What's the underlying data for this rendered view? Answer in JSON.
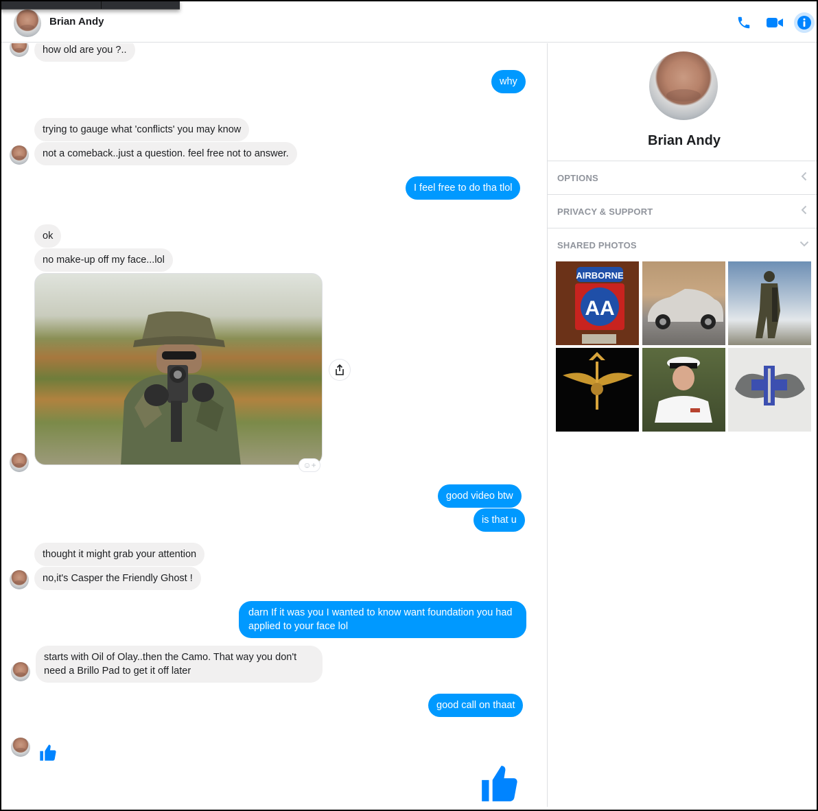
{
  "header": {
    "contact_name": "Brian Andy",
    "icons": [
      "phone-icon",
      "video-camera-icon",
      "info-icon"
    ],
    "accent_color": "#0084ff"
  },
  "messages": [
    {
      "from": "them",
      "text": "how old are you ?.."
    },
    {
      "from": "me",
      "text": "why"
    },
    {
      "from": "them",
      "text": "trying to gauge what 'conflicts' you may know"
    },
    {
      "from": "them",
      "text": "not a comeback..just a question. feel free not to answer."
    },
    {
      "from": "me",
      "text": "I feel free to do tha tlol"
    },
    {
      "from": "them",
      "text": "ok"
    },
    {
      "from": "them",
      "text": "no make-up off my face...lol"
    },
    {
      "from": "them",
      "type": "photo",
      "description_icon": "photo-soldier"
    },
    {
      "from": "me",
      "text": "good video btw"
    },
    {
      "from": "me",
      "text": "is that u"
    },
    {
      "from": "them",
      "text": "thought it might grab your attention"
    },
    {
      "from": "them",
      "text": "no,it's Casper the Friendly Ghost !"
    },
    {
      "from": "me",
      "text": "darn If it was you I wanted to know want foundation you had applied to your face lol"
    },
    {
      "from": "them",
      "text": "starts with Oil of Olay..then the Camo. That way you don't need a Brillo Pad to get it off later"
    },
    {
      "from": "me",
      "text": "good call on thaat"
    },
    {
      "from": "them",
      "type": "like",
      "icon": "thumbs-up-icon"
    },
    {
      "from": "me",
      "type": "like",
      "icon": "thumbs-up-icon"
    }
  ],
  "panel": {
    "contact_name": "Brian Andy",
    "sections": [
      {
        "label": "OPTIONS",
        "icon": "chevron-left-icon"
      },
      {
        "label": "PRIVACY & SUPPORT",
        "icon": "chevron-left-icon"
      },
      {
        "label": "SHARED PHOTOS",
        "icon": "chevron-down-icon"
      }
    ],
    "shared_photos": [
      {
        "name": "airborne-patch-photo",
        "text": "AIRBORNE"
      },
      {
        "name": "car-photo"
      },
      {
        "name": "soldier-silhouette-photo"
      },
      {
        "name": "navy-seal-trident-photo"
      },
      {
        "name": "navy-officer-photo"
      },
      {
        "name": "medic-wings-badge-photo"
      }
    ]
  }
}
